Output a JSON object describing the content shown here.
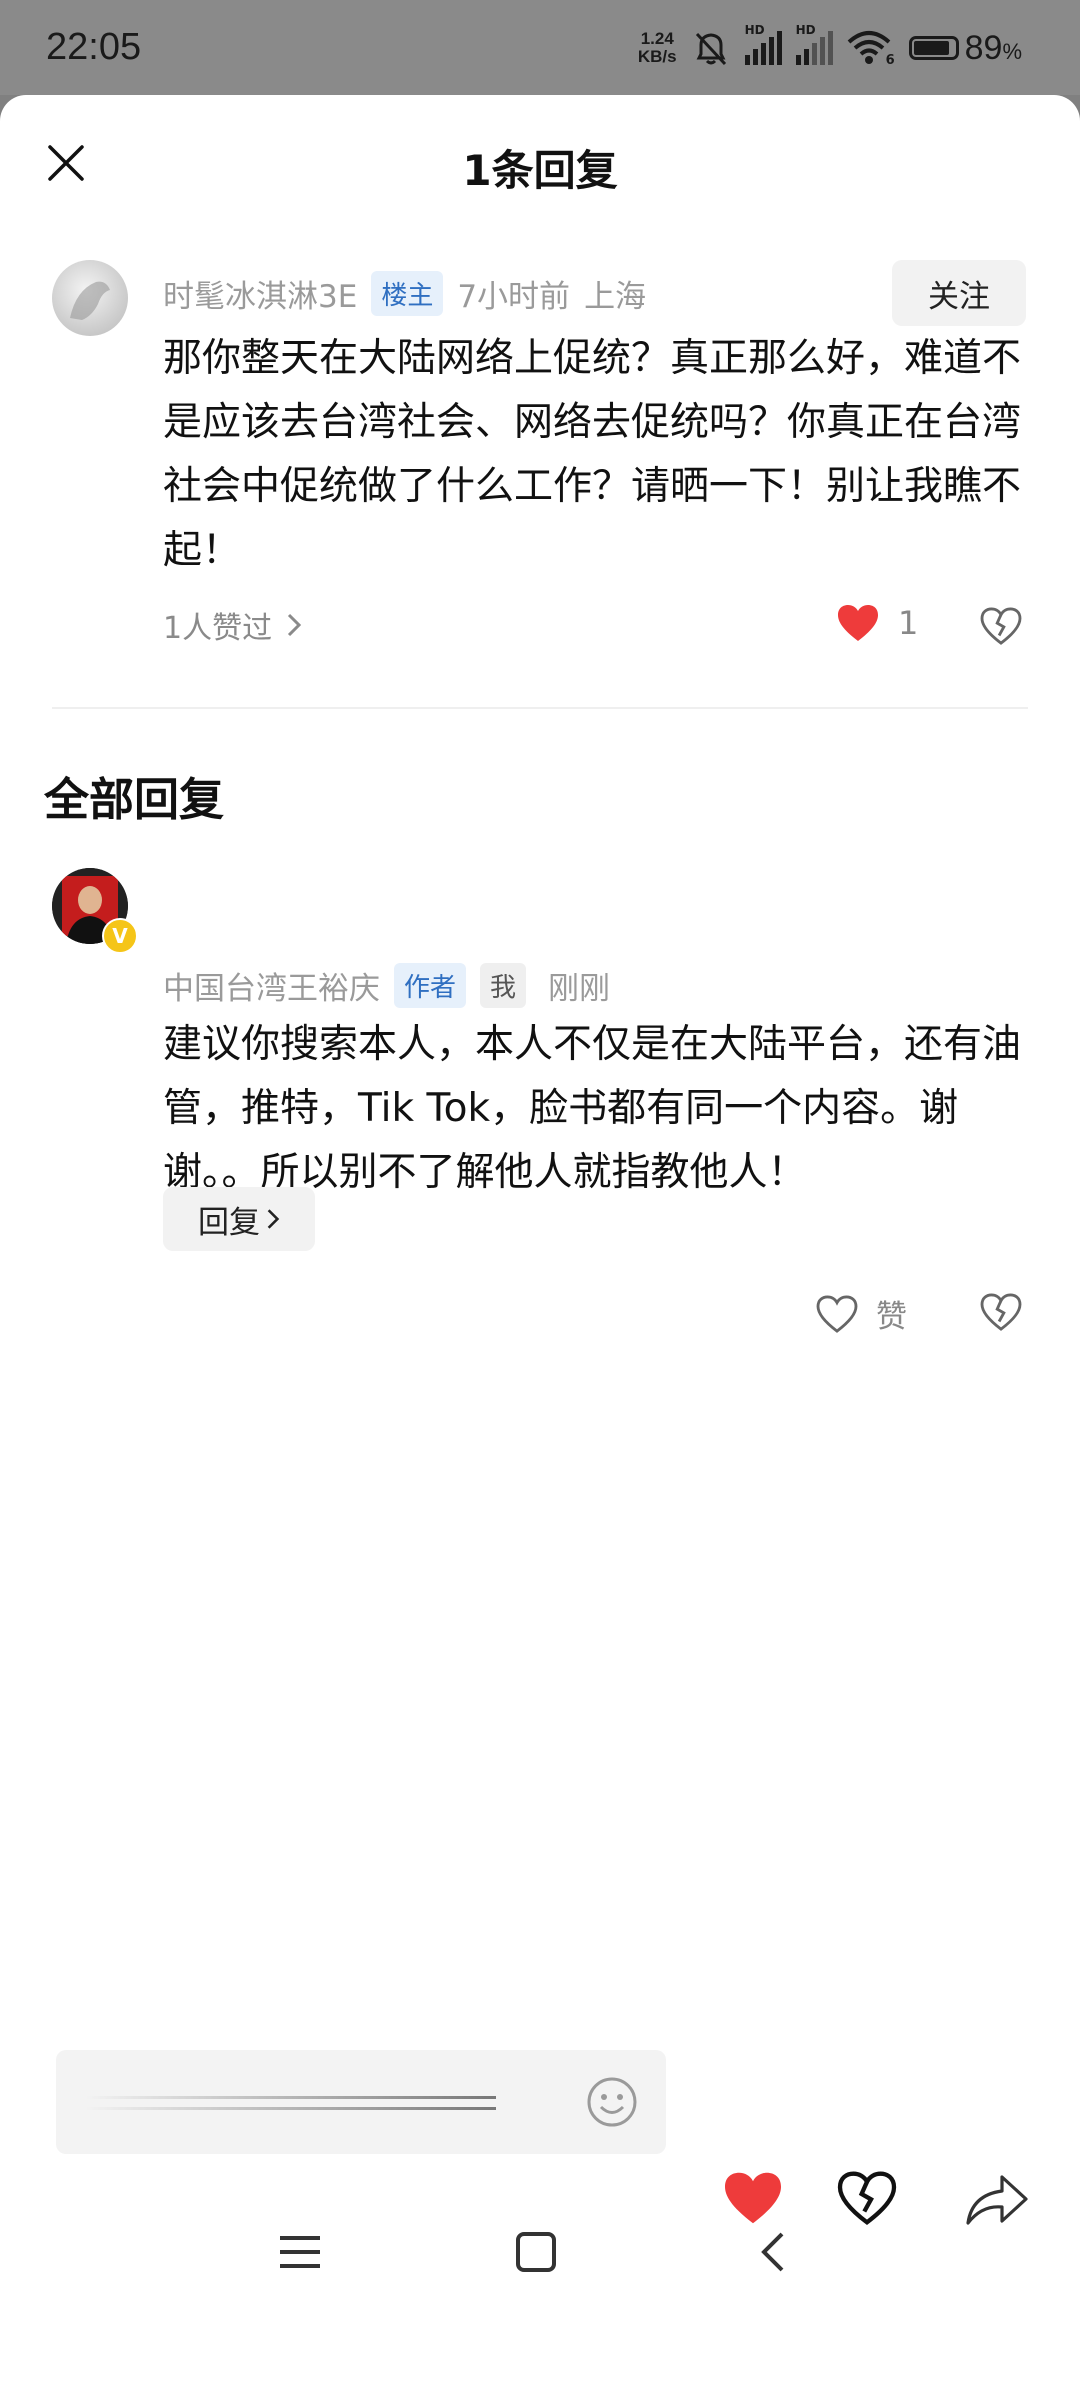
{
  "status_bar": {
    "time": "22:05",
    "net_speed_value": "1.24",
    "net_speed_unit": "KB/s",
    "signal_1_label": "HD",
    "signal_2_label": "HD",
    "wifi_badge": "6",
    "battery_level": 89,
    "battery_percent": "89",
    "battery_sign": "%"
  },
  "sheet": {
    "title": "1条回复",
    "close_icon": "close-icon"
  },
  "original_comment": {
    "username": "时髦冰淇淋3E",
    "badge": "楼主",
    "time": "7小时前",
    "location": "上海",
    "follow_label": "关注",
    "text": "那你整天在大陆网络上促统？真正那么好，难道不是应该去台湾社会、网络去促统吗？你真正在台湾社会中促统做了什么工作？请晒一下！别让我瞧不起！",
    "likers_label": "1人赞过",
    "like_count": "1",
    "liked": true
  },
  "replies": {
    "section_title": "全部回复",
    "items": [
      {
        "username": "中国台湾王裕庆",
        "author_badge": "作者",
        "me_badge": "我",
        "time": "刚刚",
        "verified_mark": "V",
        "text": "建议你搜索本人，本人不仅是在大陆平台，还有油管，推特，Tik Tok，脸书都有同一个内容。谢谢。。所以别不了解他人就指教他人！",
        "reply_label": "回复",
        "like_label": "赞"
      }
    ]
  },
  "bottom_bar": {
    "emoji_icon": "smiley-icon",
    "like_icon": "heart-filled-icon",
    "dislike_icon": "broken-heart-icon",
    "share_icon": "share-arrow-icon"
  },
  "colors": {
    "accent_red": "#ee3b3b",
    "tag_blue": "#2f6fc1",
    "muted_text": "#9a9a9a"
  }
}
